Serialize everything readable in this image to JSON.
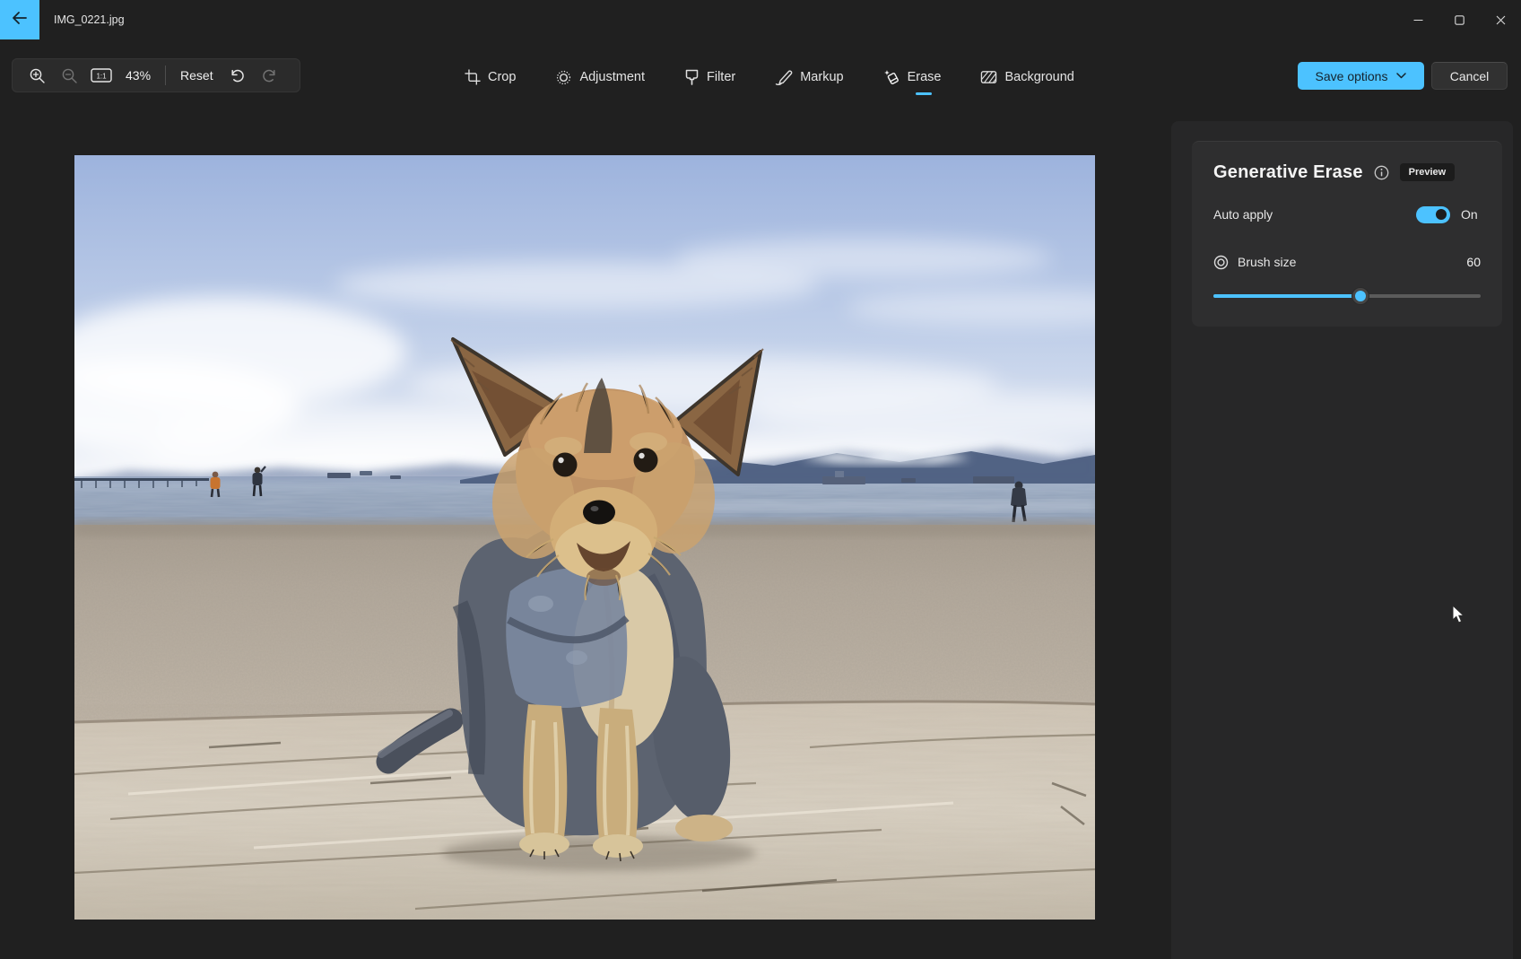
{
  "titlebar": {
    "title": "IMG_0221.jpg"
  },
  "toolbar": {
    "zoom_value": "43%",
    "reset": "Reset"
  },
  "tabs": [
    {
      "label": "Crop",
      "selected": false
    },
    {
      "label": "Adjustment",
      "selected": false
    },
    {
      "label": "Filter",
      "selected": false
    },
    {
      "label": "Markup",
      "selected": false
    },
    {
      "label": "Erase",
      "selected": true
    },
    {
      "label": "Background",
      "selected": false
    }
  ],
  "actions": {
    "save": "Save options",
    "cancel": "Cancel"
  },
  "panel": {
    "title": "Generative Erase",
    "badge": "Preview",
    "auto_apply": {
      "label": "Auto apply",
      "state_label": "On",
      "on": true
    },
    "brush": {
      "label": "Brush size",
      "value": "60",
      "percent": 55
    }
  },
  "colors": {
    "accent": "#4CC2FF",
    "app_bg": "#202020",
    "pane_bg": "#272728",
    "card_bg": "#2E2E2F",
    "toolbar_bg": "#2B2B2B"
  }
}
